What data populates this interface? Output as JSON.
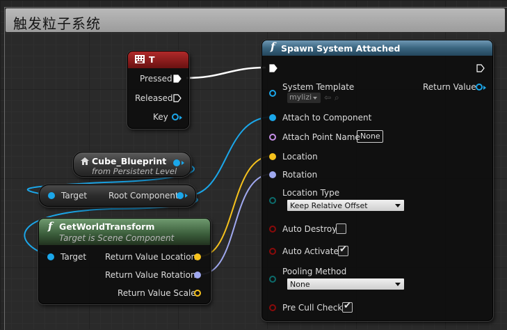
{
  "comment": {
    "title": "触发粒子系统"
  },
  "key_node": {
    "title": "T",
    "pins": {
      "pressed": "Pressed",
      "released": "Released",
      "key": "Key"
    }
  },
  "ref_node": {
    "title": "Cube_Blueprint",
    "subtitle": "from Persistent Level"
  },
  "root_node": {
    "target": "Target",
    "output": "Root Component"
  },
  "transform_node": {
    "title": "GetWorldTransform",
    "subtitle": "Target is Scene Component",
    "target": "Target",
    "out_location": "Return Value Location",
    "out_rotation": "Return Value Rotation",
    "out_scale": "Return Value Scale"
  },
  "spawn_node": {
    "title": "Spawn System Attached",
    "system_template": "System Template",
    "system_template_value": "mylizi",
    "return_value": "Return Value",
    "attach_to_component": "Attach to Component",
    "attach_point_name": "Attach Point Name",
    "attach_point_value": "None",
    "location": "Location",
    "rotation": "Rotation",
    "location_type": "Location Type",
    "location_type_value": "Keep Relative Offset",
    "auto_destroy": "Auto Destroy",
    "auto_destroy_checked": false,
    "auto_activate": "Auto Activate",
    "auto_activate_checked": true,
    "pooling_method": "Pooling Method",
    "pooling_method_value": "None",
    "pre_cull_check": "Pre Cull Check",
    "pre_cull_check_checked": true
  },
  "colors": {
    "key_header": "#8b1a1a",
    "spawn_header": "#3a6f90",
    "transform_header": "#3f6a3f",
    "object_pin": "#1ba7ea",
    "name_pin": "#c58fe8",
    "vector_pin": "#f6c21d",
    "rotator_pin": "#9fa8ef",
    "transform_pin": "#f2a100",
    "enum_pin": "#0c6b6b",
    "bool_pin": "#8a0a0a",
    "exec_pin": "#ffffff"
  },
  "icons": {
    "key_icon": "keyboard-icon",
    "ref_icon": "house-icon",
    "func_icon": "function-icon"
  }
}
